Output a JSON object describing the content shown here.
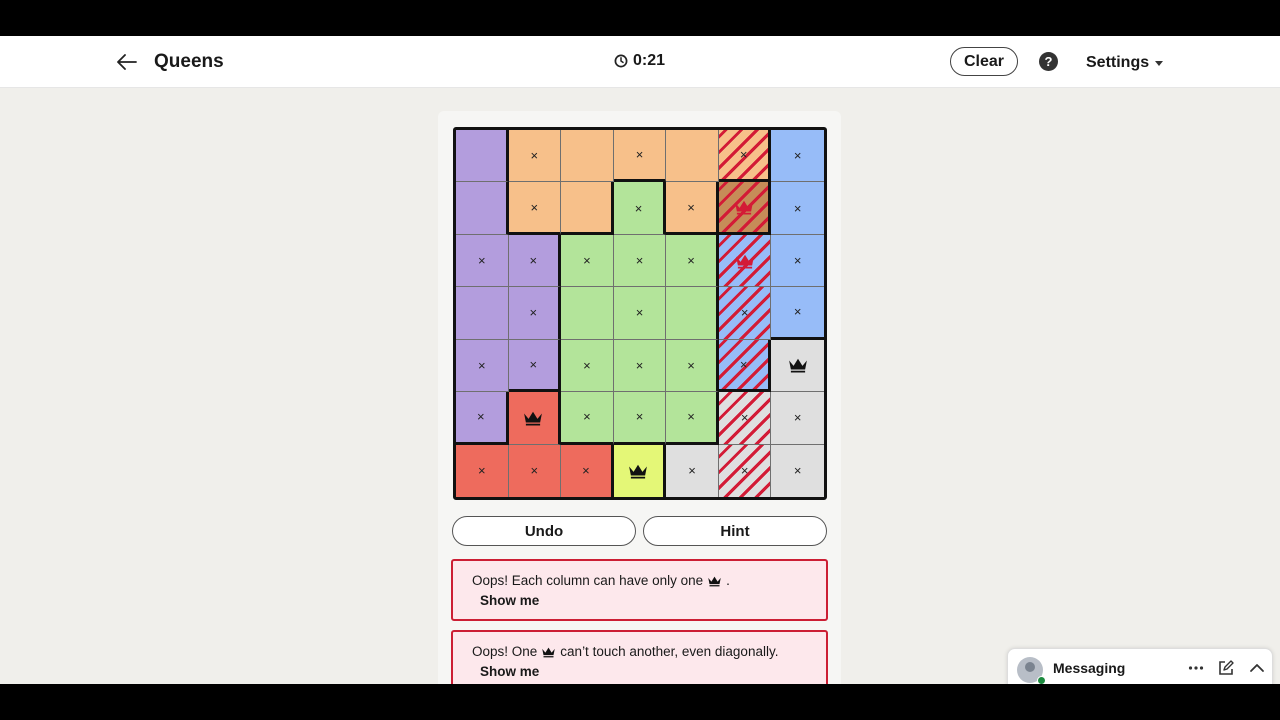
{
  "header": {
    "title": "Queens",
    "timer": "0:21",
    "clear_label": "Clear",
    "help_label": "?",
    "settings_label": "Settings"
  },
  "colors": {
    "purple": "#b39ddd",
    "orange": "#f7c08a",
    "blue": "#97bcf8",
    "green": "#b3e49a",
    "gray": "#dfdfdf",
    "red": "#ee6b5d",
    "yellow": "#e4f777",
    "dark-orange": "#c68c58",
    "conflict": "#d31b36"
  },
  "board": {
    "size": 7,
    "regions": [
      [
        "purple",
        "orange",
        "orange",
        "orange",
        "orange",
        "orange",
        "blue"
      ],
      [
        "purple",
        "orange",
        "orange",
        "green",
        "orange",
        "dark-orange",
        "blue"
      ],
      [
        "purple",
        "purple",
        "green",
        "green",
        "green",
        "blue",
        "blue"
      ],
      [
        "purple",
        "purple",
        "green",
        "green",
        "green",
        "blue",
        "blue"
      ],
      [
        "purple",
        "purple",
        "green",
        "green",
        "green",
        "blue",
        "gray"
      ],
      [
        "purple",
        "red",
        "green",
        "green",
        "green",
        "gray",
        "gray"
      ],
      [
        "red",
        "red",
        "red",
        "yellow",
        "gray",
        "gray",
        "gray"
      ]
    ],
    "cells": [
      [
        "",
        "x",
        "",
        "x",
        "",
        "x",
        "x"
      ],
      [
        "",
        "x",
        "",
        "x",
        "x",
        "Q",
        "x"
      ],
      [
        "x",
        "x",
        "x",
        "x",
        "x",
        "Q",
        "x"
      ],
      [
        "",
        "x",
        "",
        "x",
        "",
        "x",
        "x"
      ],
      [
        "x",
        "x",
        "x",
        "x",
        "x",
        "x",
        "Q"
      ],
      [
        "x",
        "Q",
        "x",
        "x",
        "x",
        "x",
        "x"
      ],
      [
        "x",
        "x",
        "x",
        "Q",
        "x",
        "x",
        "x"
      ]
    ],
    "conflict_column": 5,
    "conflict_queens": [
      [
        1,
        5
      ],
      [
        2,
        5
      ]
    ]
  },
  "controls": {
    "undo_label": "Undo",
    "hint_label": "Hint"
  },
  "errors": [
    {
      "before": "Oops! Each column can have only one",
      "after": ".",
      "action": "Show me"
    },
    {
      "before": "Oops! One",
      "after": "can’t touch another, even diagonally.",
      "action": "Show me"
    }
  ],
  "messaging": {
    "label": "Messaging"
  }
}
